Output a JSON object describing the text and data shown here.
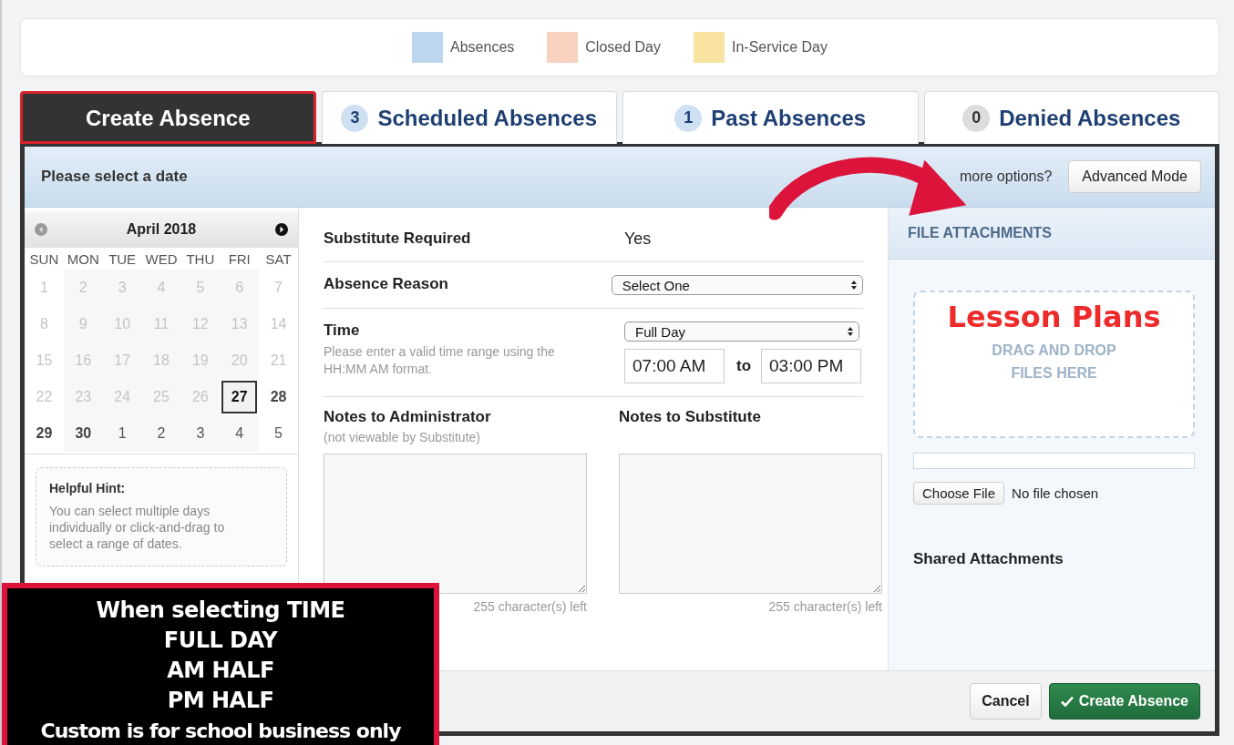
{
  "legend": [
    {
      "label": "Absences",
      "color": "#bcd6ee"
    },
    {
      "label": "Closed Day",
      "color": "#f9d2c0"
    },
    {
      "label": "In-Service Day",
      "color": "#f8e4a0"
    }
  ],
  "tabs": [
    {
      "label": "Create Absence",
      "selected": true
    },
    {
      "count": "3",
      "label": "Scheduled Absences",
      "selected": false
    },
    {
      "count": "1",
      "label": "Past Absences",
      "selected": false
    },
    {
      "count": "0",
      "label": "Denied Absences",
      "selected": false
    }
  ],
  "header": {
    "title": "Please select a date",
    "prompt": "more options?",
    "button": "Advanced Mode"
  },
  "calendar": {
    "month": "April 2018",
    "weekdays": [
      "SUN",
      "MON",
      "TUE",
      "WED",
      "THU",
      "FRI",
      "SAT"
    ],
    "weeks": [
      [
        {
          "label": "1",
          "kind": "past",
          "selected": false
        },
        {
          "label": "2",
          "kind": "past",
          "selected": false
        },
        {
          "label": "3",
          "kind": "past",
          "selected": false
        },
        {
          "label": "4",
          "kind": "past",
          "selected": false
        },
        {
          "label": "5",
          "kind": "past",
          "selected": false
        },
        {
          "label": "6",
          "kind": "past",
          "selected": false
        },
        {
          "label": "7",
          "kind": "past",
          "selected": false
        }
      ],
      [
        {
          "label": "8",
          "kind": "past",
          "selected": false
        },
        {
          "label": "9",
          "kind": "past",
          "selected": false
        },
        {
          "label": "10",
          "kind": "past",
          "selected": false
        },
        {
          "label": "11",
          "kind": "past",
          "selected": false
        },
        {
          "label": "12",
          "kind": "past",
          "selected": false
        },
        {
          "label": "13",
          "kind": "past",
          "selected": false
        },
        {
          "label": "14",
          "kind": "past",
          "selected": false
        }
      ],
      [
        {
          "label": "15",
          "kind": "past",
          "selected": false
        },
        {
          "label": "16",
          "kind": "past",
          "selected": false
        },
        {
          "label": "17",
          "kind": "past",
          "selected": false
        },
        {
          "label": "18",
          "kind": "past",
          "selected": false
        },
        {
          "label": "19",
          "kind": "past",
          "selected": false
        },
        {
          "label": "20",
          "kind": "past",
          "selected": false
        },
        {
          "label": "21",
          "kind": "past",
          "selected": false
        }
      ],
      [
        {
          "label": "22",
          "kind": "past",
          "selected": false
        },
        {
          "label": "23",
          "kind": "past",
          "selected": false
        },
        {
          "label": "24",
          "kind": "past",
          "selected": false
        },
        {
          "label": "25",
          "kind": "past",
          "selected": false
        },
        {
          "label": "26",
          "kind": "past",
          "selected": false
        },
        {
          "label": "27",
          "kind": "open",
          "selected": true
        },
        {
          "label": "28",
          "kind": "open",
          "selected": false
        }
      ],
      [
        {
          "label": "29",
          "kind": "open",
          "selected": false
        },
        {
          "label": "30",
          "kind": "open",
          "selected": false
        },
        {
          "label": "1",
          "kind": "next",
          "selected": false
        },
        {
          "label": "2",
          "kind": "next",
          "selected": false
        },
        {
          "label": "3",
          "kind": "next",
          "selected": false
        },
        {
          "label": "4",
          "kind": "next",
          "selected": false
        },
        {
          "label": "5",
          "kind": "next",
          "selected": false
        }
      ]
    ]
  },
  "hint": {
    "title": "Helpful Hint:",
    "text": "You can select multiple days individually or click-and-drag to select a range of dates."
  },
  "form": {
    "substitute": {
      "label": "Substitute Required",
      "value": "Yes"
    },
    "reason": {
      "label": "Absence Reason",
      "value": "Select One"
    },
    "time": {
      "label": "Time",
      "help": "Please enter a valid time range using the HH:MM AM format.",
      "mode": "Full Day",
      "start": "07:00 AM",
      "to": "to",
      "end": "03:00 PM"
    },
    "notes": [
      {
        "label": "Notes to Administrator",
        "sublabel": "(not viewable by Substitute)",
        "counter": "255 character(s) left"
      },
      {
        "label": "Notes to Substitute",
        "counter": "255 character(s) left"
      }
    ]
  },
  "attachments": {
    "title": "FILE ATTACHMENTS",
    "drop": "DRAG AND DROP FILES HERE",
    "choose": "Choose File",
    "status": "No file chosen",
    "shared": "Shared Attachments"
  },
  "footer": {
    "cancel": "Cancel",
    "submit": "Create Absence"
  },
  "annotations": {
    "label": "Lesson Plans",
    "note": [
      "When selecting TIME",
      "FULL DAY",
      "AM HALF",
      "PM HALF",
      "Custom is for school business only"
    ]
  }
}
